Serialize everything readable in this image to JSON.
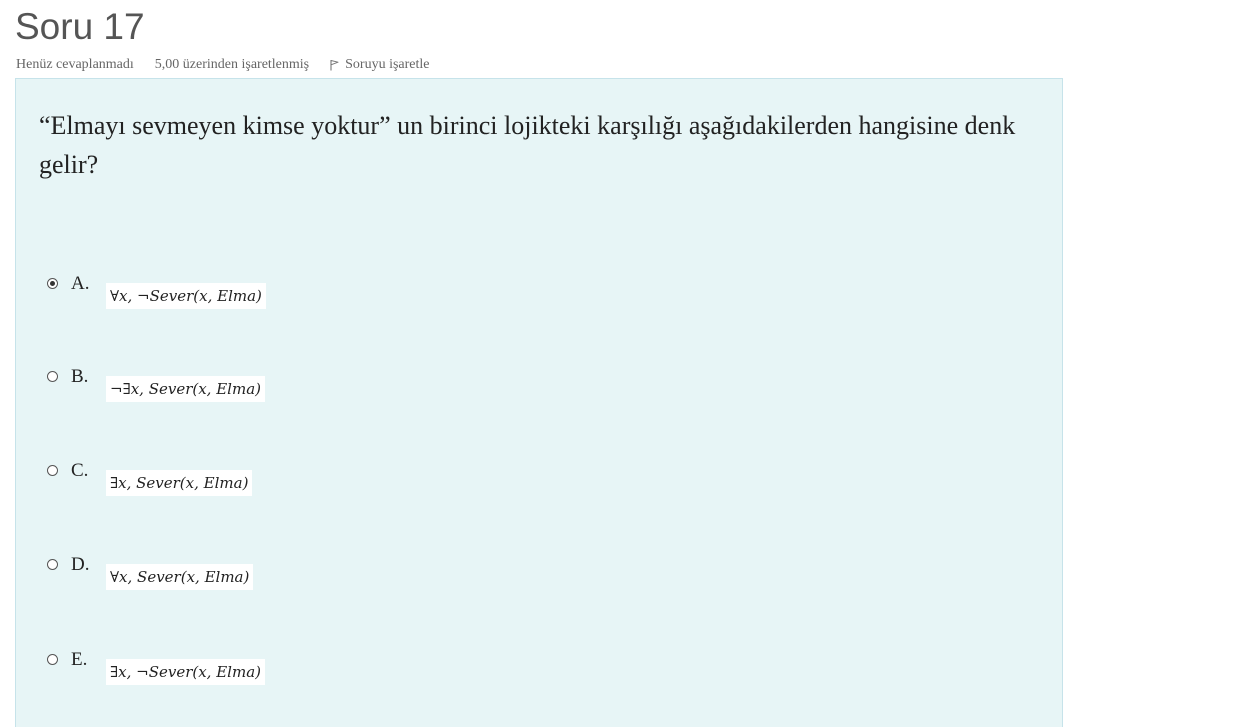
{
  "question": {
    "title": "Soru 17",
    "state": "Henüz cevaplanmadı",
    "grade": "5,00 üzerinden işaretlenmiş",
    "flag_label": "Soruyu işaretle",
    "text": "“Elmayı sevmeyen kimse yoktur” un birinci lojikteki karşılığı aşağıdakilerden hangisine denk gelir?"
  },
  "options": [
    {
      "letter": "A.",
      "formula": "∀x, ¬Sever(x, Elma)",
      "selected": true
    },
    {
      "letter": "B.",
      "formula": "¬∃x, Sever(x, Elma)",
      "selected": false
    },
    {
      "letter": "C.",
      "formula": "∃x, Sever(x, Elma)",
      "selected": false
    },
    {
      "letter": "D.",
      "formula": "∀x, Sever(x, Elma)",
      "selected": false
    },
    {
      "letter": "E.",
      "formula": "∃x, ¬Sever(x, Elma)",
      "selected": false
    }
  ],
  "colors": {
    "content_bg": "#e7f5f6",
    "content_border": "#c6e3ea",
    "title": "#555555"
  },
  "icons": {
    "flag": "flag-icon"
  }
}
